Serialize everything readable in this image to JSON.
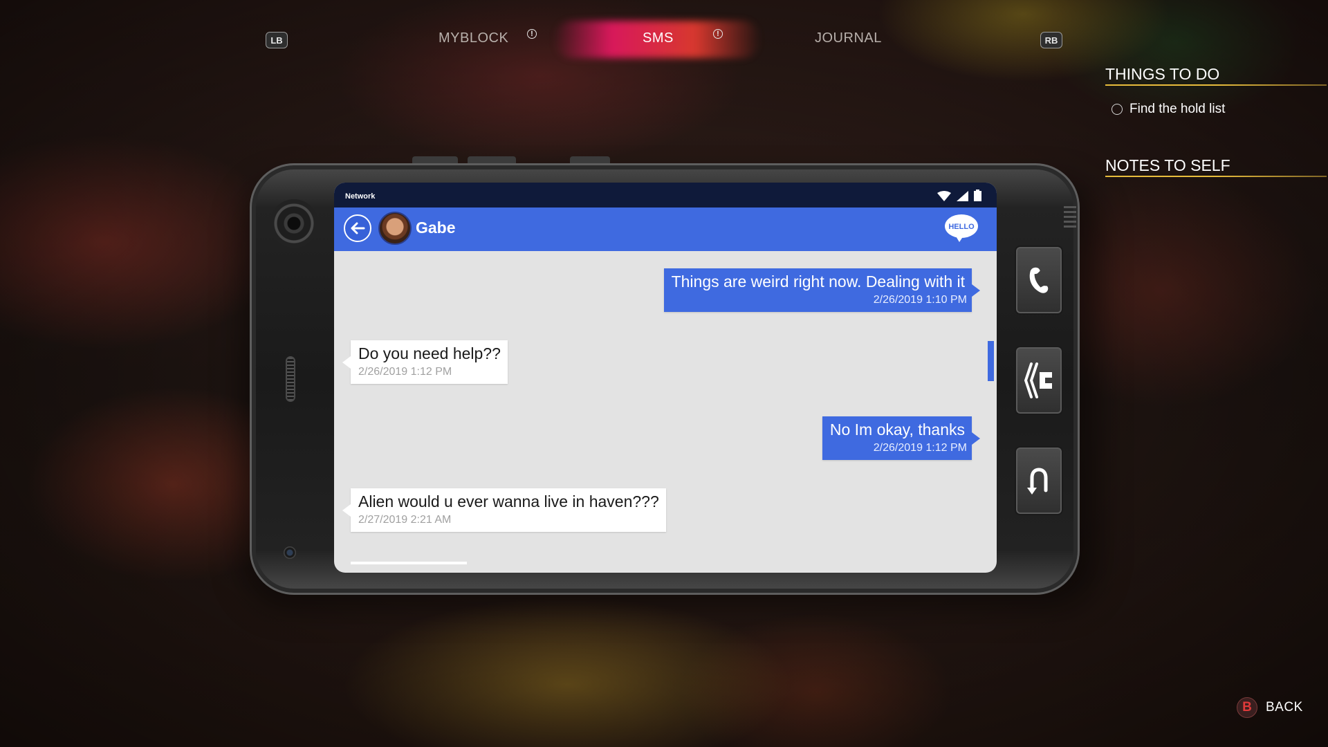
{
  "nav": {
    "left_bumper": "LB",
    "right_bumper": "RB",
    "tabs": [
      {
        "label": "MYBLOCK",
        "alert": true
      },
      {
        "label": "SMS",
        "alert": true,
        "active": true
      },
      {
        "label": "JOURNAL",
        "alert": false
      }
    ],
    "alert_glyph": "!",
    "active_glow_colors": [
      "#e0196a",
      "#f08c28"
    ]
  },
  "right_panel": {
    "things_to_do_heading": "THINGS TO DO",
    "tasks": [
      {
        "label": "Find the hold list",
        "done": false
      }
    ],
    "notes_heading": "NOTES TO SELF"
  },
  "phone": {
    "status_bar": {
      "network_label": "Network",
      "icons": [
        "wifi-icon",
        "signal-icon",
        "battery-icon"
      ]
    },
    "header": {
      "contact_name": "Gabe",
      "hello_badge": "HELLO",
      "accent_color": "#3f6ae0"
    },
    "messages": [
      {
        "direction": "out",
        "text": "Things are weird right now. Dealing with it",
        "time": "2/26/2019 1:10 PM"
      },
      {
        "direction": "in",
        "text": "Do you need help??",
        "time": "2/26/2019 1:12 PM"
      },
      {
        "direction": "out",
        "text": "No Im okay, thanks",
        "time": "2/26/2019 1:12 PM"
      },
      {
        "direction": "in",
        "text": "Alien would u ever wanna live in haven???",
        "time": "2/27/2019 2:21 AM"
      }
    ],
    "side_buttons": [
      "phone-call-icon",
      "lock-icon",
      "undo-icon"
    ]
  },
  "footer": {
    "back_button_glyph": "B",
    "back_label": "BACK"
  }
}
